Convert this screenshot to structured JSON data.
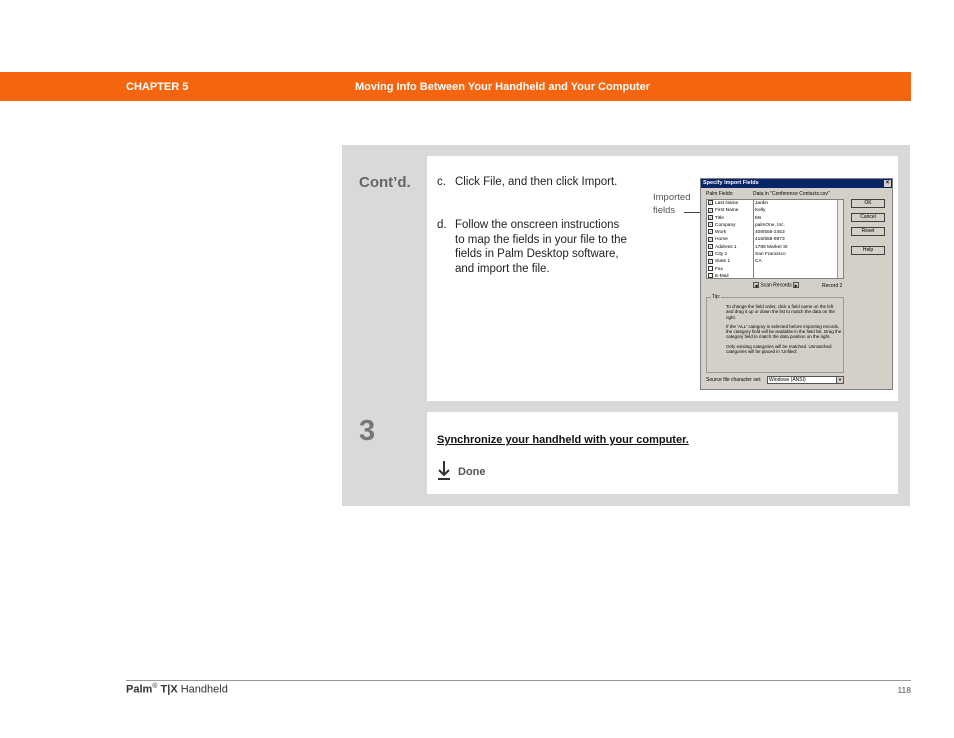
{
  "header": {
    "chapter": "CHAPTER 5",
    "title": "Moving Info Between Your Handheld and Your Computer"
  },
  "step1": {
    "label": "Cont’d.",
    "instructions": [
      {
        "letter": "c.",
        "text": "Click File, and then click Import."
      },
      {
        "letter": "d.",
        "text": "Follow the onscreen instructions to map the fields in your file to the fields in Palm Desktop software, and import the file."
      }
    ],
    "callout": "Imported\nfields"
  },
  "dialog": {
    "title": "Specify Import Fields",
    "close": "×",
    "palm_fields_header": "Palm Fields:",
    "data_header": "Data in \"Conference Contacts.csv\"",
    "fields": [
      {
        "name": "Last Name",
        "checked": true
      },
      {
        "name": "First Name",
        "checked": true
      },
      {
        "name": "Title",
        "checked": true
      },
      {
        "name": "Company",
        "checked": true
      },
      {
        "name": "Work",
        "checked": true
      },
      {
        "name": "Home",
        "checked": true
      },
      {
        "name": "Address 1",
        "checked": true
      },
      {
        "name": "City 1",
        "checked": true
      },
      {
        "name": "State 1",
        "checked": true
      },
      {
        "name": "Fax",
        "checked": false
      },
      {
        "name": "E-Mail",
        "checked": false
      }
    ],
    "data_values": [
      "Jardin",
      "Kelly",
      "Ms",
      "palmOne, Inc.",
      "408/555-2453",
      "415/555-9873",
      "1789 Market St",
      "San Francisco",
      "CA"
    ],
    "buttons": {
      "ok": "OK",
      "cancel": "Cancel",
      "reset": "Reset",
      "help": "Help"
    },
    "scan_label": "Scan Records",
    "record_label": "Record 2",
    "tip_legend": "Tip:",
    "tips": [
      "To change the field order, click a field name on the left and drag it up or down the list to match the data on the right.",
      "If the 'ALL' category is selected before importing records, the category field will be available in the field list. Drag the category field to match the data position on the right.",
      "Only existing categories will be matched. Unmatched categories will be placed in 'Unfiled'."
    ],
    "charset_label": "Source file character set:",
    "charset_value": "Windows (ANSI)"
  },
  "step3": {
    "number": "3",
    "link": "Synchronize your handheld with your computer.",
    "done": "Done"
  },
  "footer": {
    "brand": "Palm",
    "reg": "®",
    "model": "T|X",
    "suffix": "Handheld",
    "page": "118"
  },
  "colors": {
    "header_bg": "#f5650f",
    "panel_bg": "#d9d9d9"
  }
}
